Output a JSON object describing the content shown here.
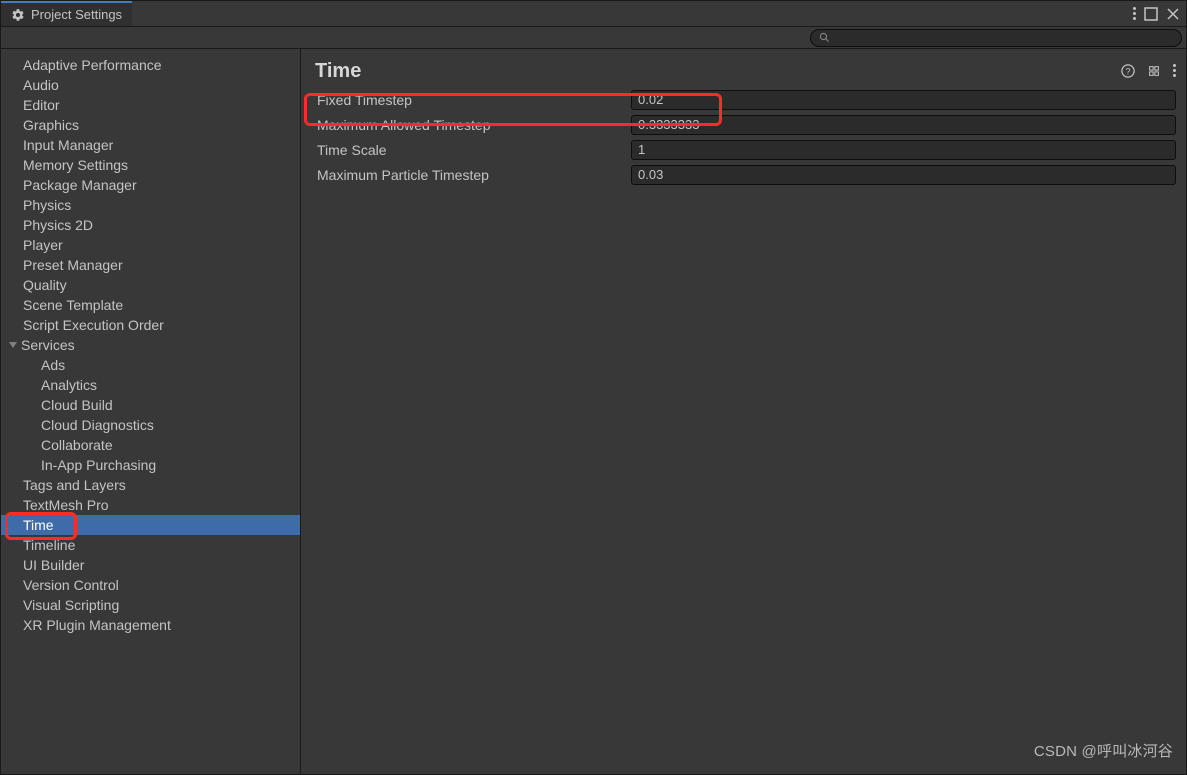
{
  "tab_title": "Project Settings",
  "sidebar": {
    "items": [
      {
        "label": "Adaptive Performance"
      },
      {
        "label": "Audio"
      },
      {
        "label": "Editor"
      },
      {
        "label": "Graphics"
      },
      {
        "label": "Input Manager"
      },
      {
        "label": "Memory Settings"
      },
      {
        "label": "Package Manager"
      },
      {
        "label": "Physics"
      },
      {
        "label": "Physics 2D"
      },
      {
        "label": "Player"
      },
      {
        "label": "Preset Manager"
      },
      {
        "label": "Quality"
      },
      {
        "label": "Scene Template"
      },
      {
        "label": "Script Execution Order"
      },
      {
        "label": "Services",
        "expanded": true,
        "children": [
          {
            "label": "Ads"
          },
          {
            "label": "Analytics"
          },
          {
            "label": "Cloud Build"
          },
          {
            "label": "Cloud Diagnostics"
          },
          {
            "label": "Collaborate"
          },
          {
            "label": "In-App Purchasing"
          }
        ]
      },
      {
        "label": "Tags and Layers"
      },
      {
        "label": "TextMesh Pro"
      },
      {
        "label": "Time",
        "selected": true
      },
      {
        "label": "Timeline"
      },
      {
        "label": "UI Builder"
      },
      {
        "label": "Version Control"
      },
      {
        "label": "Visual Scripting"
      },
      {
        "label": "XR Plugin Management"
      }
    ]
  },
  "content": {
    "title": "Time",
    "properties": [
      {
        "label": "Fixed Timestep",
        "value": "0.02"
      },
      {
        "label": "Maximum Allowed Timestep",
        "value": "0.3333333"
      },
      {
        "label": "Time Scale",
        "value": "1"
      },
      {
        "label": "Maximum Particle Timestep",
        "value": "0.03"
      }
    ]
  },
  "watermark": "CSDN @呼叫冰河谷"
}
